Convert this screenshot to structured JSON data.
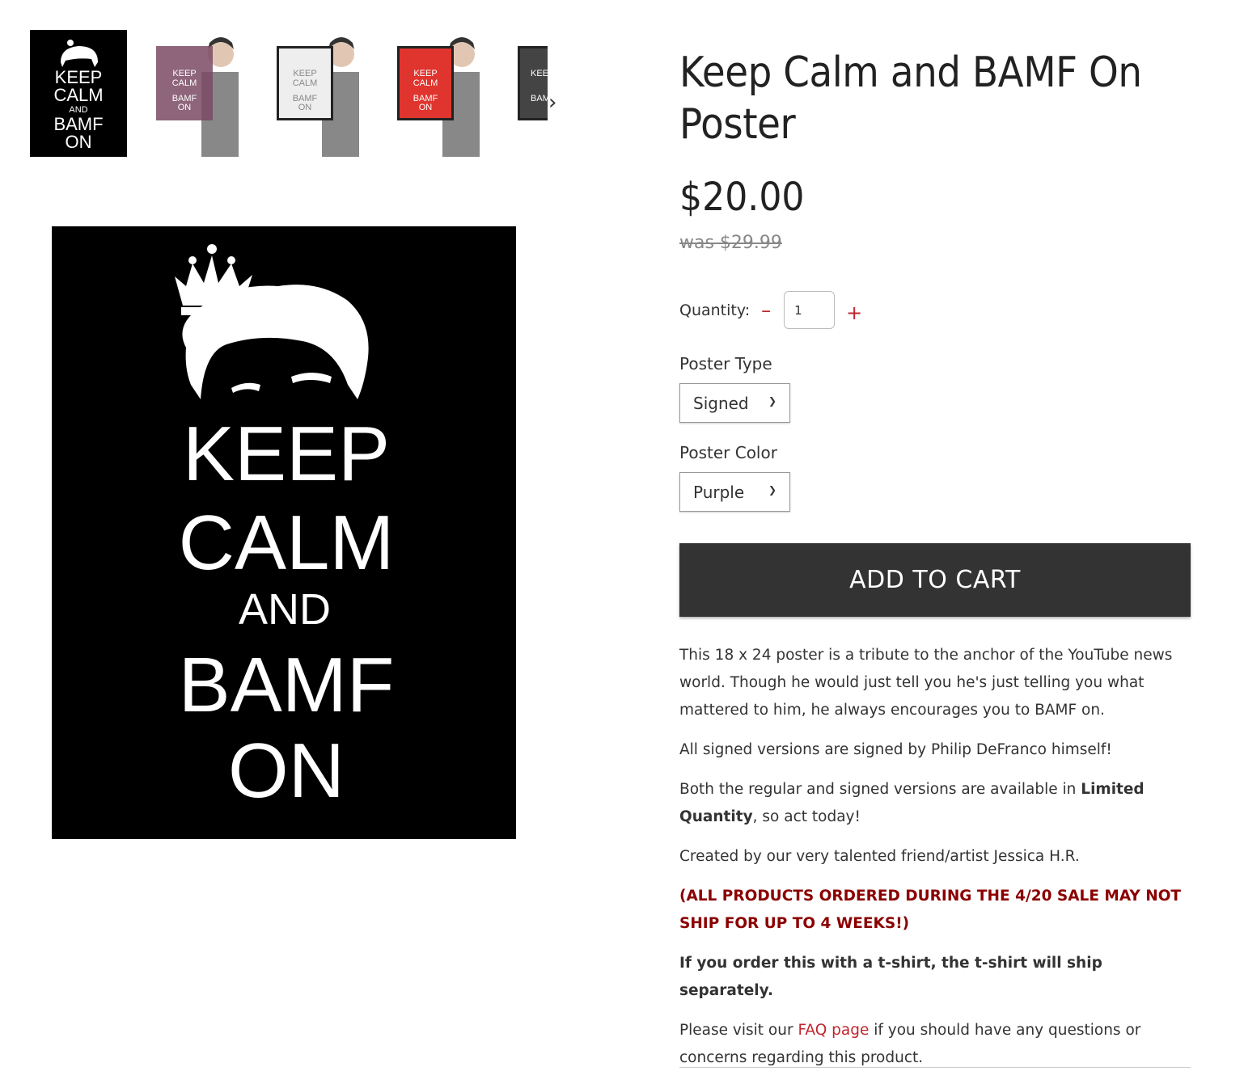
{
  "thumbnails": {
    "poster_lines": [
      "KEEP",
      "CALM",
      "AND",
      "BAMF",
      "ON"
    ],
    "items": [
      {
        "color": "#000000",
        "kind": "poster"
      },
      {
        "color": "#7a4a63",
        "kind": "person"
      },
      {
        "color": "#eeeeee",
        "kind": "person"
      },
      {
        "color": "#e0352e",
        "kind": "person"
      },
      {
        "color": "#444444",
        "kind": "person"
      }
    ],
    "next_icon": "›"
  },
  "main_image": {
    "lines": [
      "KEEP",
      "CALM",
      "AND",
      "BAMF",
      "ON"
    ],
    "background": "#000000"
  },
  "product": {
    "title": "Keep Calm and BAMF On Poster",
    "price": "$20.00",
    "was_price": "was $29.99",
    "quantity_label": "Quantity:",
    "quantity_value": "1",
    "minus": "–",
    "plus": "+",
    "poster_type_label": "Poster Type",
    "poster_type_value": "Signed",
    "poster_color_label": "Poster Color",
    "poster_color_value": "Purple",
    "add_to_cart": "ADD TO CART"
  },
  "description": {
    "p1": "This 18 x 24 poster is a tribute to the anchor of the YouTube news world. Though he would just tell you he's just telling you what mattered to him, he always encourages you to BAMF on.",
    "p2": "All signed versions are signed by Philip DeFranco himself!",
    "p3_before": "Both the regular and signed versions are available in ",
    "p3_bold": "Limited Quantity",
    "p3_after": ", so act today!",
    "p4": "Created by our very talented friend/artist Jessica H.R.",
    "p5": "(ALL PRODUCTS ORDERED DURING THE 4/20 SALE MAY NOT SHIP FOR UP TO 4 WEEKS!)",
    "p6": "If you order this with a t-shirt, the t-shirt will ship separately.",
    "p7_before": "Please visit our ",
    "p7_link": "FAQ page",
    "p7_after": " if you should have any questions or concerns regarding this product."
  },
  "colors": {
    "accent_red": "#c0262d",
    "note_red": "#8b0000",
    "button_bg": "#333333"
  }
}
